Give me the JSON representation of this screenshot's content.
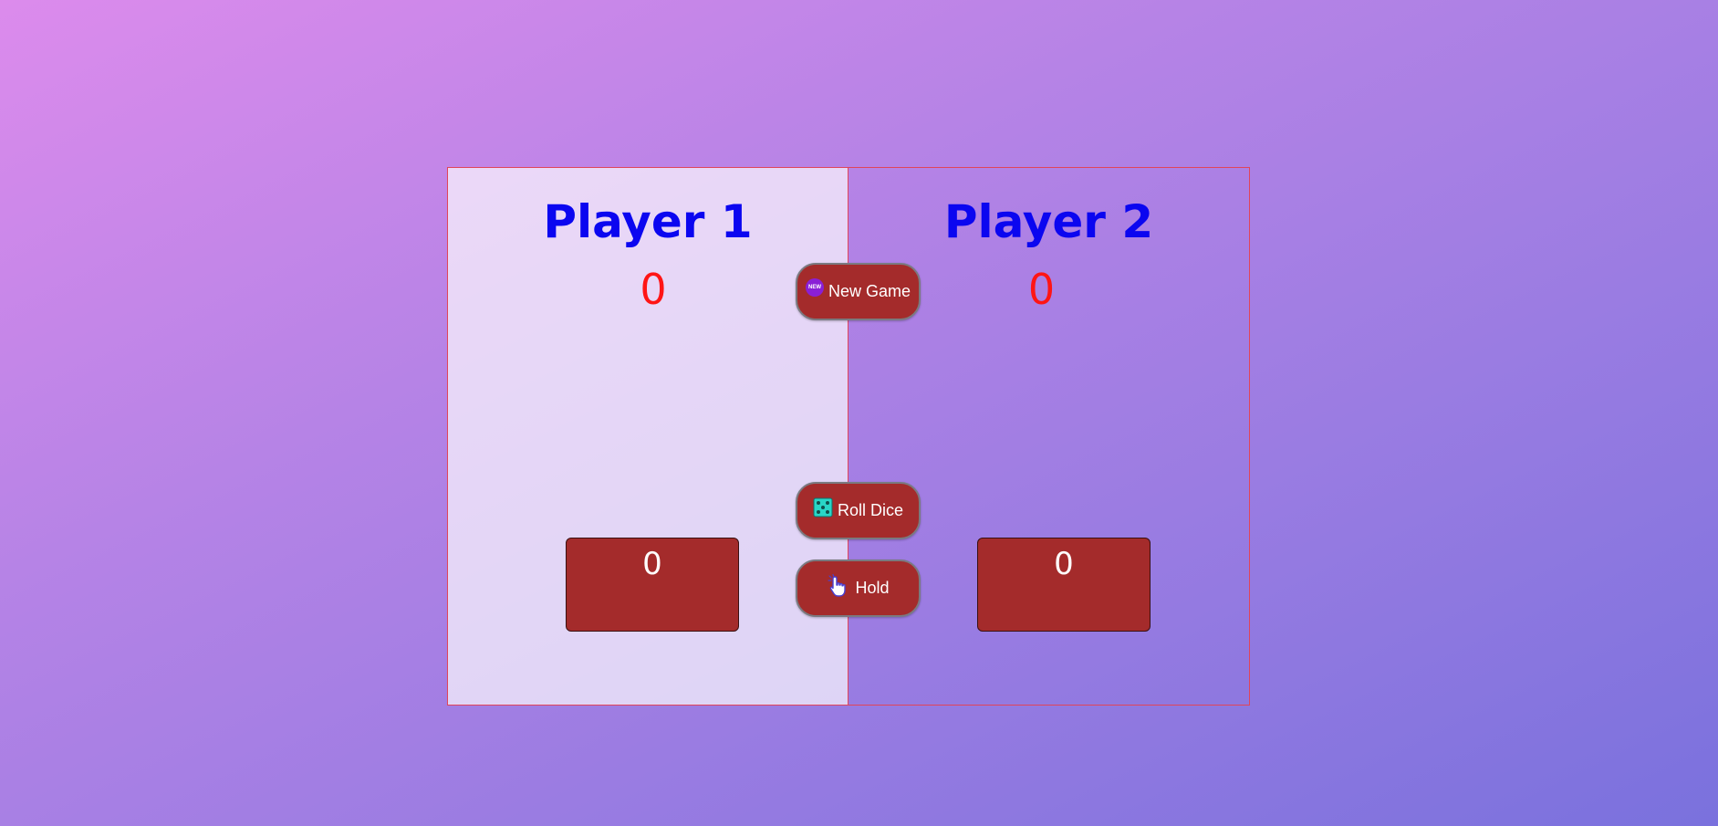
{
  "players": [
    {
      "name": "Player 1",
      "total_score": "0",
      "current_score": "0"
    },
    {
      "name": "Player 2",
      "total_score": "0",
      "current_score": "0"
    }
  ],
  "buttons": {
    "new_game": {
      "label": "New Game",
      "icon": "new-badge-icon",
      "icon_text": "NEW"
    },
    "roll_dice": {
      "label": "Roll Dice",
      "icon": "dice-icon"
    },
    "hold": {
      "label": "Hold",
      "icon": "hand-pointer-icon"
    }
  },
  "colors": {
    "player_name": "#0b06f0",
    "total_score": "#ff1515",
    "box_background": "#a42b2b",
    "panel_border": "#e0455a",
    "dice": "#29d6c6",
    "new_badge": "#8a1fd6"
  }
}
